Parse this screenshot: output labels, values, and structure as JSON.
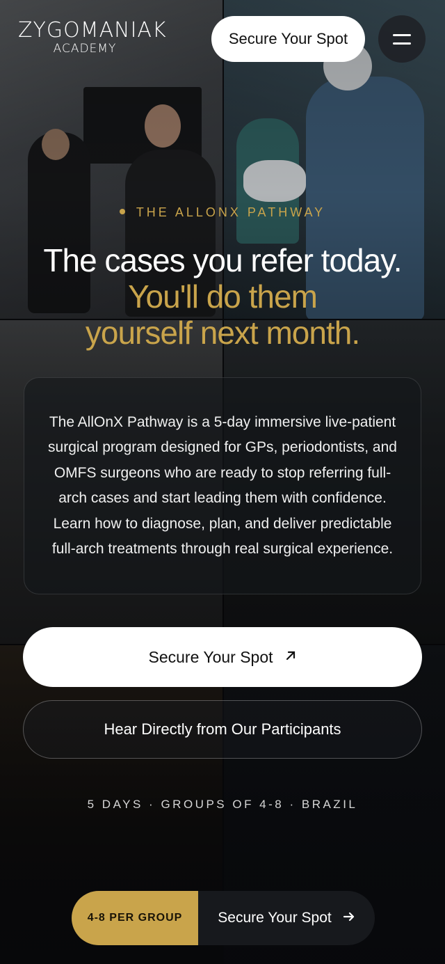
{
  "brand": {
    "logo_line1": "ZYGOMANIAK",
    "logo_line2": "ACADEMY"
  },
  "header": {
    "cta_label": "Secure Your Spot",
    "menu_icon": "hamburger-icon"
  },
  "hero": {
    "eyebrow": "THE ALLONX PATHWAY",
    "headline_line1": "The cases you refer today.",
    "headline_line2": "You'll do them",
    "headline_line3": "yourself next month.",
    "description": "The AllOnX Pathway is a 5-day immersive live-patient surgical program designed for GPs, periodontists, and OMFS surgeons who are ready to stop referring full-arch cases and start leading them with confidence. Learn how to diagnose, plan, and deliver predictable full-arch treatments through real surgical experience.",
    "primary_cta": "Secure Your Spot",
    "primary_cta_icon": "arrow-up-right-icon",
    "secondary_cta": "Hear Directly from Our Participants",
    "meta": "5 DAYS · GROUPS OF 4-8 · BRAZIL"
  },
  "sticky_bar": {
    "badge": "4-8 PER GROUP",
    "action_label": "Secure Your Spot",
    "action_icon": "arrow-right-icon"
  },
  "colors": {
    "accent": "#c9a44b",
    "background": "#0c0d10"
  }
}
